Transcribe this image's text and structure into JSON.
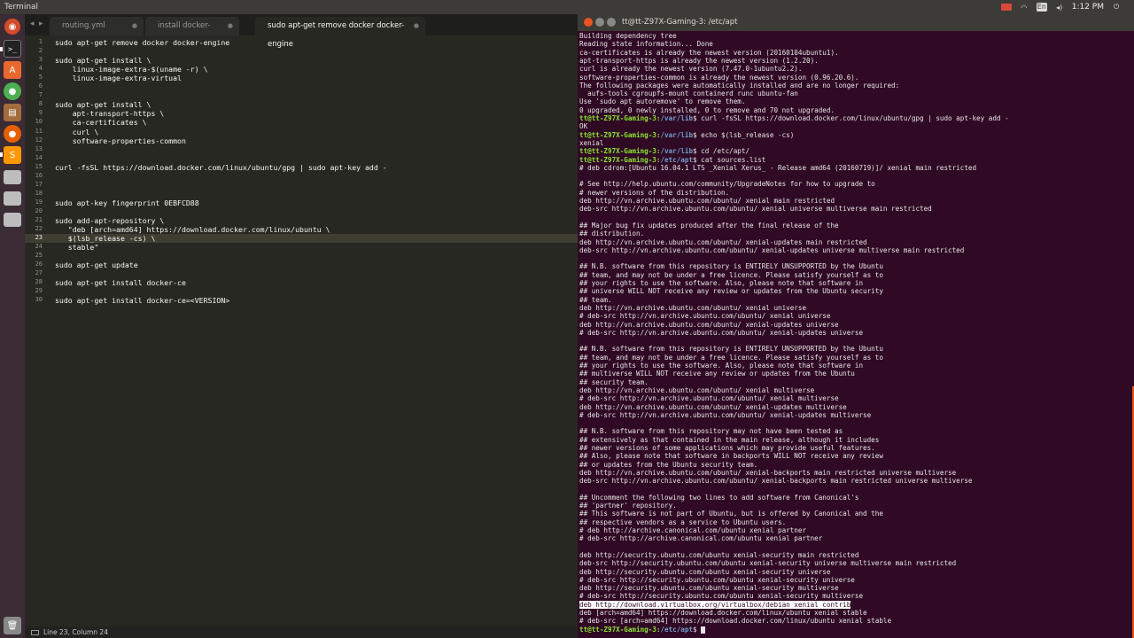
{
  "top_panel": {
    "app_title": "Terminal",
    "keyboard": "En",
    "clock": "1:12 PM"
  },
  "editor": {
    "tabs": [
      {
        "label": "routing.yml"
      },
      {
        "label": "install docker-compose"
      },
      {
        "label": "sudo apt-get remove docker docker-engine"
      }
    ],
    "lines": [
      "sudo apt-get remove docker docker-engine",
      "",
      "sudo apt-get install \\",
      "    linux-image-extra-$(uname -r) \\",
      "    linux-image-extra-virtual",
      "",
      "",
      "sudo apt-get install \\",
      "    apt-transport-https \\",
      "    ca-certificates \\",
      "    curl \\",
      "    software-properties-common",
      "",
      "",
      "curl -fsSL https://download.docker.com/linux/ubuntu/gpg | sudo apt-key add -",
      "",
      "",
      "",
      "sudo apt-key fingerprint 0EBFCD88",
      "",
      "sudo add-apt-repository \\",
      "   \"deb [arch=amd64] https://download.docker.com/linux/ubuntu \\",
      "   $(lsb_release -cs) \\",
      "   stable\"",
      "",
      "sudo apt-get update",
      "",
      "sudo apt-get install docker-ce",
      "",
      "sudo apt-get install docker-ce=<VERSION>"
    ],
    "line_numbers": [
      "1",
      "2",
      "3",
      "4",
      "5",
      "6",
      "7",
      "8",
      "9",
      "10",
      "11",
      "12",
      "13",
      "14",
      "15",
      "16",
      "17",
      "18",
      "19",
      "20",
      "21",
      "22",
      "23",
      "24",
      "25",
      "26",
      "27",
      "28",
      "29",
      "30"
    ],
    "status": "Line 23, Column 24"
  },
  "terminal": {
    "title": "tt@tt-Z97X-Gaming-3: /etc/apt",
    "prompt_user": "tt@tt-Z97X-Gaming-3",
    "lines": [
      {
        "t": "Building dependency tree"
      },
      {
        "t": "Reading state information... Done"
      },
      {
        "t": "ca-certificates is already the newest version (20160104ubuntu1)."
      },
      {
        "t": "apt-transport-https is already the newest version (1.2.20)."
      },
      {
        "t": "curl is already the newest version (7.47.0-1ubuntu2.2)."
      },
      {
        "t": "software-properties-common is already the newest version (0.96.20.6)."
      },
      {
        "t": "The following packages were automatically installed and are no longer required:"
      },
      {
        "t": "  aufs-tools cgroupfs-mount containerd runc ubuntu-fan"
      },
      {
        "t": "Use 'sudo apt autoremove' to remove them."
      },
      {
        "t": "0 upgraded, 0 newly installed, 0 to remove and 70 not upgraded."
      },
      {
        "p": "/var/lib",
        "t": "$ curl -fsSL https://download.docker.com/linux/ubuntu/gpg | sudo apt-key add -"
      },
      {
        "t": "OK"
      },
      {
        "p": "/var/lib",
        "t": "$ echo $(lsb_release -cs)"
      },
      {
        "t": "xenial"
      },
      {
        "p": "/var/lib",
        "t": "$ cd /etc/apt/"
      },
      {
        "p": "/etc/apt",
        "t": "$ cat sources.list"
      },
      {
        "t": "# deb cdrom:[Ubuntu 16.04.1 LTS _Xenial Xerus_ - Release amd64 (20160719)]/ xenial main restricted"
      },
      {
        "t": ""
      },
      {
        "t": "# See http://help.ubuntu.com/community/UpgradeNotes for how to upgrade to"
      },
      {
        "t": "# newer versions of the distribution."
      },
      {
        "t": "deb http://vn.archive.ubuntu.com/ubuntu/ xenial main restricted"
      },
      {
        "t": "deb-src http://vn.archive.ubuntu.com/ubuntu/ xenial universe multiverse main restricted"
      },
      {
        "t": ""
      },
      {
        "t": "## Major bug fix updates produced after the final release of the"
      },
      {
        "t": "## distribution."
      },
      {
        "t": "deb http://vn.archive.ubuntu.com/ubuntu/ xenial-updates main restricted"
      },
      {
        "t": "deb-src http://vn.archive.ubuntu.com/ubuntu/ xenial-updates universe multiverse main restricted"
      },
      {
        "t": ""
      },
      {
        "t": "## N.B. software from this repository is ENTIRELY UNSUPPORTED by the Ubuntu"
      },
      {
        "t": "## team, and may not be under a free licence. Please satisfy yourself as to"
      },
      {
        "t": "## your rights to use the software. Also, please note that software in"
      },
      {
        "t": "## universe WILL NOT receive any review or updates from the Ubuntu security"
      },
      {
        "t": "## team."
      },
      {
        "t": "deb http://vn.archive.ubuntu.com/ubuntu/ xenial universe"
      },
      {
        "t": "# deb-src http://vn.archive.ubuntu.com/ubuntu/ xenial universe"
      },
      {
        "t": "deb http://vn.archive.ubuntu.com/ubuntu/ xenial-updates universe"
      },
      {
        "t": "# deb-src http://vn.archive.ubuntu.com/ubuntu/ xenial-updates universe"
      },
      {
        "t": ""
      },
      {
        "t": "## N.B. software from this repository is ENTIRELY UNSUPPORTED by the Ubuntu"
      },
      {
        "t": "## team, and may not be under a free licence. Please satisfy yourself as to"
      },
      {
        "t": "## your rights to use the software. Also, please note that software in"
      },
      {
        "t": "## multiverse WILL NOT receive any review or updates from the Ubuntu"
      },
      {
        "t": "## security team."
      },
      {
        "t": "deb http://vn.archive.ubuntu.com/ubuntu/ xenial multiverse"
      },
      {
        "t": "# deb-src http://vn.archive.ubuntu.com/ubuntu/ xenial multiverse"
      },
      {
        "t": "deb http://vn.archive.ubuntu.com/ubuntu/ xenial-updates multiverse"
      },
      {
        "t": "# deb-src http://vn.archive.ubuntu.com/ubuntu/ xenial-updates multiverse"
      },
      {
        "t": ""
      },
      {
        "t": "## N.B. software from this repository may not have been tested as"
      },
      {
        "t": "## extensively as that contained in the main release, although it includes"
      },
      {
        "t": "## newer versions of some applications which may provide useful features."
      },
      {
        "t": "## Also, please note that software in backports WILL NOT receive any review"
      },
      {
        "t": "## or updates from the Ubuntu security team."
      },
      {
        "t": "deb http://vn.archive.ubuntu.com/ubuntu/ xenial-backports main restricted universe multiverse"
      },
      {
        "t": "deb-src http://vn.archive.ubuntu.com/ubuntu/ xenial-backports main restricted universe multiverse"
      },
      {
        "t": ""
      },
      {
        "t": "## Uncomment the following two lines to add software from Canonical's"
      },
      {
        "t": "## 'partner' repository."
      },
      {
        "t": "## This software is not part of Ubuntu, but is offered by Canonical and the"
      },
      {
        "t": "## respective vendors as a service to Ubuntu users."
      },
      {
        "t": "# deb http://archive.canonical.com/ubuntu xenial partner"
      },
      {
        "t": "# deb-src http://archive.canonical.com/ubuntu xenial partner"
      },
      {
        "t": ""
      },
      {
        "t": "deb http://security.ubuntu.com/ubuntu xenial-security main restricted"
      },
      {
        "t": "deb-src http://security.ubuntu.com/ubuntu xenial-security universe multiverse main restricted"
      },
      {
        "t": "deb http://security.ubuntu.com/ubuntu xenial-security universe"
      },
      {
        "t": "# deb-src http://security.ubuntu.com/ubuntu xenial-security universe"
      },
      {
        "t": "deb http://security.ubuntu.com/ubuntu xenial-security multiverse"
      },
      {
        "t": "# deb-src http://security.ubuntu.com/ubuntu xenial-security multiverse"
      },
      {
        "t": "deb http://download.virtualbox.org/virtualbox/debian xenial contrib",
        "sel": true
      },
      {
        "t": "deb [arch=amd64] https://download.docker.com/linux/ubuntu xenial stable"
      },
      {
        "t": "# deb-src [arch=amd64] https://download.docker.com/linux/ubuntu xenial stable"
      },
      {
        "p": "/etc/apt",
        "t": "$ ",
        "cursor": true
      }
    ]
  }
}
